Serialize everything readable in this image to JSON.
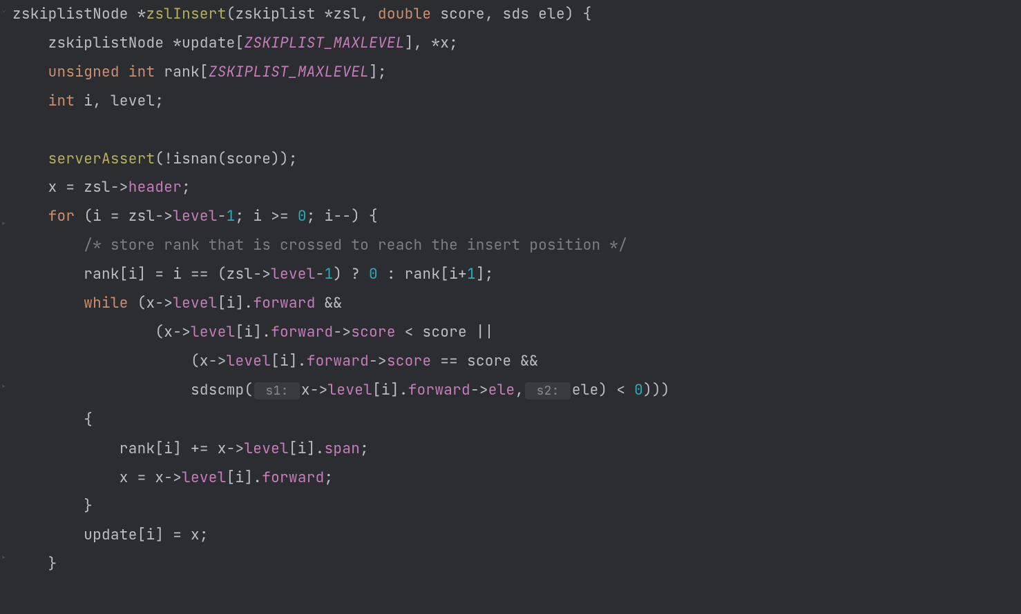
{
  "code": {
    "l1": {
      "a": "zskiplistNode *",
      "b": "zslInsert",
      "c": "(zskiplist *zsl",
      "d": ", ",
      "e": "double",
      "f": " score",
      "g": ", ",
      "h": "sds ele) {"
    },
    "l2": {
      "a": "    zskiplistNode *update[",
      "b": "ZSKIPLIST_MAXLEVEL",
      "c": "], *x;"
    },
    "l3": {
      "a": "    ",
      "b": "unsigned",
      "c": " ",
      "d": "int",
      "e": " rank[",
      "f": "ZSKIPLIST_MAXLEVEL",
      "g": "];"
    },
    "l4": {
      "a": "    ",
      "b": "int",
      "c": " i",
      "d": ", ",
      "e": "level;"
    },
    "l5": "",
    "l6": {
      "a": "    ",
      "b": "serverAssert",
      "c": "(!isnan(score));"
    },
    "l7": {
      "a": "    x = zsl->",
      "b": "header",
      "c": ";"
    },
    "l8": {
      "a": "    ",
      "b": "for",
      "c": " (i = zsl->",
      "d": "level",
      "e": "-",
      "f": "1",
      "g": "; i >= ",
      "h": "0",
      "i": "; i--) {"
    },
    "l9": {
      "a": "        ",
      "b": "/* store rank that is crossed to reach the insert position */"
    },
    "l10": {
      "a": "        rank[i] = i == (zsl->",
      "b": "level",
      "c": "-",
      "d": "1",
      "e": ") ? ",
      "f": "0",
      "g": " : rank[i+",
      "h": "1",
      "i": "];"
    },
    "l11": {
      "a": "        ",
      "b": "while",
      "c": " (x->",
      "d": "level",
      "e": "[i].",
      "f": "forward",
      "g": " &&"
    },
    "l12": {
      "a": "                (x->",
      "b": "level",
      "c": "[i].",
      "d": "forward",
      "e": "->",
      "f": "score",
      "g": " < score ||"
    },
    "l13": {
      "a": "                    (x->",
      "b": "level",
      "c": "[i].",
      "d": "forward",
      "e": "->",
      "f": "score",
      "g": " == score &&"
    },
    "l14": {
      "a": "                    sdscmp(",
      "h1": " s1: ",
      "b": "x->",
      "c": "level",
      "d": "[i].",
      "e": "forward",
      "f": "->",
      "g": "ele",
      "h": ",",
      "h2": " s2: ",
      "i": "ele) < ",
      "j": "0",
      "k": ")))"
    },
    "l15": "        {",
    "l16": {
      "a": "            rank[i] += x->",
      "b": "level",
      "c": "[i].",
      "d": "span",
      "e": ";"
    },
    "l17": {
      "a": "            x = x->",
      "b": "level",
      "c": "[i].",
      "d": "forward",
      "e": ";"
    },
    "l18": "        }",
    "l19": "        update[i] = x;",
    "l20": "    }"
  }
}
